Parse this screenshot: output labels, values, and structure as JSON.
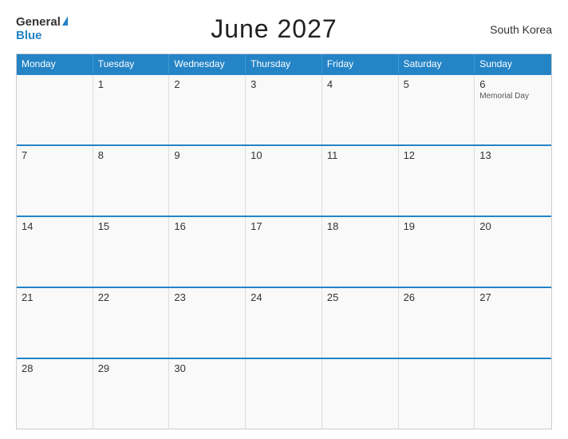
{
  "header": {
    "logo_general": "General",
    "logo_blue": "Blue",
    "title": "June 2027",
    "country": "South Korea"
  },
  "calendar": {
    "weekdays": [
      "Monday",
      "Tuesday",
      "Wednesday",
      "Thursday",
      "Friday",
      "Saturday",
      "Sunday"
    ],
    "weeks": [
      [
        {
          "day": "",
          "holiday": ""
        },
        {
          "day": "1",
          "holiday": ""
        },
        {
          "day": "2",
          "holiday": ""
        },
        {
          "day": "3",
          "holiday": ""
        },
        {
          "day": "4",
          "holiday": ""
        },
        {
          "day": "5",
          "holiday": ""
        },
        {
          "day": "6",
          "holiday": "Memorial Day"
        }
      ],
      [
        {
          "day": "7",
          "holiday": ""
        },
        {
          "day": "8",
          "holiday": ""
        },
        {
          "day": "9",
          "holiday": ""
        },
        {
          "day": "10",
          "holiday": ""
        },
        {
          "day": "11",
          "holiday": ""
        },
        {
          "day": "12",
          "holiday": ""
        },
        {
          "day": "13",
          "holiday": ""
        }
      ],
      [
        {
          "day": "14",
          "holiday": ""
        },
        {
          "day": "15",
          "holiday": ""
        },
        {
          "day": "16",
          "holiday": ""
        },
        {
          "day": "17",
          "holiday": ""
        },
        {
          "day": "18",
          "holiday": ""
        },
        {
          "day": "19",
          "holiday": ""
        },
        {
          "day": "20",
          "holiday": ""
        }
      ],
      [
        {
          "day": "21",
          "holiday": ""
        },
        {
          "day": "22",
          "holiday": ""
        },
        {
          "day": "23",
          "holiday": ""
        },
        {
          "day": "24",
          "holiday": ""
        },
        {
          "day": "25",
          "holiday": ""
        },
        {
          "day": "26",
          "holiday": ""
        },
        {
          "day": "27",
          "holiday": ""
        }
      ],
      [
        {
          "day": "28",
          "holiday": ""
        },
        {
          "day": "29",
          "holiday": ""
        },
        {
          "day": "30",
          "holiday": ""
        },
        {
          "day": "",
          "holiday": ""
        },
        {
          "day": "",
          "holiday": ""
        },
        {
          "day": "",
          "holiday": ""
        },
        {
          "day": "",
          "holiday": ""
        }
      ]
    ]
  }
}
